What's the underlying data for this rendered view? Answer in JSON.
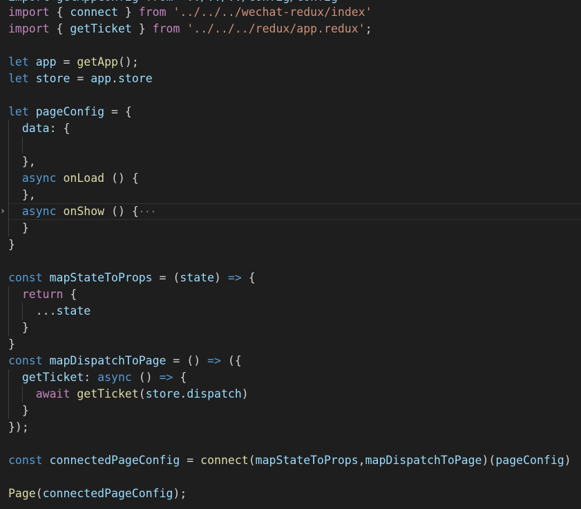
{
  "editor": {
    "top_partial": "import getAppConfig from '../../../config/config'",
    "lines": [
      [
        [
          "import",
          "c"
        ],
        [
          " { ",
          "p"
        ],
        [
          "connect",
          "v"
        ],
        [
          " } ",
          "p"
        ],
        [
          "from",
          "c"
        ],
        [
          " ",
          "p"
        ],
        [
          "'../../../wechat-redux/index'",
          "s"
        ]
      ],
      [
        [
          "import",
          "c"
        ],
        [
          " { ",
          "p"
        ],
        [
          "getTicket",
          "v"
        ],
        [
          " } ",
          "p"
        ],
        [
          "from",
          "c"
        ],
        [
          " ",
          "p"
        ],
        [
          "'../../../redux/app.redux'",
          "s"
        ],
        [
          ";",
          "p"
        ]
      ],
      [],
      [
        [
          "let",
          "k"
        ],
        [
          " ",
          "p"
        ],
        [
          "app",
          "v"
        ],
        [
          " = ",
          "p"
        ],
        [
          "getApp",
          "f"
        ],
        [
          "();",
          "p"
        ]
      ],
      [
        [
          "let",
          "k"
        ],
        [
          " ",
          "p"
        ],
        [
          "store",
          "v"
        ],
        [
          " = ",
          "p"
        ],
        [
          "app",
          "v"
        ],
        [
          ".",
          "p"
        ],
        [
          "store",
          "v"
        ]
      ],
      [],
      [
        [
          "let",
          "k"
        ],
        [
          " ",
          "p"
        ],
        [
          "pageConfig",
          "v"
        ],
        [
          " = {",
          "p"
        ]
      ],
      [
        [
          "  ",
          "p"
        ],
        [
          "data",
          "v"
        ],
        [
          ": {",
          "p"
        ]
      ],
      [],
      [
        [
          "  },",
          "p"
        ]
      ],
      [
        [
          "  ",
          "p"
        ],
        [
          "async",
          "k"
        ],
        [
          " ",
          "p"
        ],
        [
          "onLoad",
          "f"
        ],
        [
          " () {",
          "p"
        ]
      ],
      [
        [
          "  },",
          "p"
        ]
      ],
      [
        [
          "  ",
          "p"
        ],
        [
          "async",
          "k"
        ],
        [
          " ",
          "p"
        ],
        [
          "onShow",
          "f"
        ],
        [
          " () {",
          "p"
        ]
      ],
      [
        [
          "  }",
          "p"
        ]
      ],
      [
        [
          "}",
          "p"
        ]
      ],
      [],
      [
        [
          "const",
          "k"
        ],
        [
          " ",
          "p"
        ],
        [
          "mapStateToProps",
          "v"
        ],
        [
          " = (",
          "p"
        ],
        [
          "state",
          "v"
        ],
        [
          ") ",
          "p"
        ],
        [
          "=>",
          "k"
        ],
        [
          " {",
          "p"
        ]
      ],
      [
        [
          "  ",
          "p"
        ],
        [
          "return",
          "c"
        ],
        [
          " {",
          "p"
        ]
      ],
      [
        [
          "    ...",
          "p"
        ],
        [
          "state",
          "v"
        ]
      ],
      [
        [
          "  }",
          "p"
        ]
      ],
      [
        [
          "}",
          "p"
        ]
      ],
      [
        [
          "const",
          "k"
        ],
        [
          " ",
          "p"
        ],
        [
          "mapDispatchToPage",
          "v"
        ],
        [
          " = () ",
          "p"
        ],
        [
          "=>",
          "k"
        ],
        [
          " ({",
          "p"
        ]
      ],
      [
        [
          "  ",
          "p"
        ],
        [
          "getTicket",
          "v"
        ],
        [
          ": ",
          "p"
        ],
        [
          "async",
          "k"
        ],
        [
          " () ",
          "p"
        ],
        [
          "=>",
          "k"
        ],
        [
          " {",
          "p"
        ]
      ],
      [
        [
          "    ",
          "p"
        ],
        [
          "await",
          "c"
        ],
        [
          " ",
          "p"
        ],
        [
          "getTicket",
          "f"
        ],
        [
          "(",
          "p"
        ],
        [
          "store",
          "v"
        ],
        [
          ".",
          "p"
        ],
        [
          "dispatch",
          "v"
        ],
        [
          ")",
          "p"
        ]
      ],
      [
        [
          "  }",
          "p"
        ]
      ],
      [
        [
          "});",
          "p"
        ]
      ],
      [],
      [
        [
          "const",
          "k"
        ],
        [
          " ",
          "p"
        ],
        [
          "connectedPageConfig",
          "v"
        ],
        [
          " = ",
          "p"
        ],
        [
          "connect",
          "f"
        ],
        [
          "(",
          "p"
        ],
        [
          "mapStateToProps",
          "v"
        ],
        [
          ",",
          "p"
        ],
        [
          "mapDispatchToPage",
          "v"
        ],
        [
          ")(",
          "p"
        ],
        [
          "pageConfig",
          "v"
        ],
        [
          ")",
          "p"
        ]
      ],
      [],
      [
        [
          "Page",
          "f"
        ],
        [
          "(",
          "p"
        ],
        [
          "connectedPageConfig",
          "v"
        ],
        [
          ");",
          "p"
        ]
      ]
    ],
    "folded_line_index": 12,
    "fold_ellipsis": "···",
    "fold_chevron": "›"
  },
  "colors": {
    "background": "#1e1e1e",
    "keyword": "#569cd6",
    "control": "#c586c0",
    "string": "#ce9178",
    "function": "#dcdcaa",
    "variable": "#9cdcfe",
    "punctuation": "#d4d4d4"
  }
}
